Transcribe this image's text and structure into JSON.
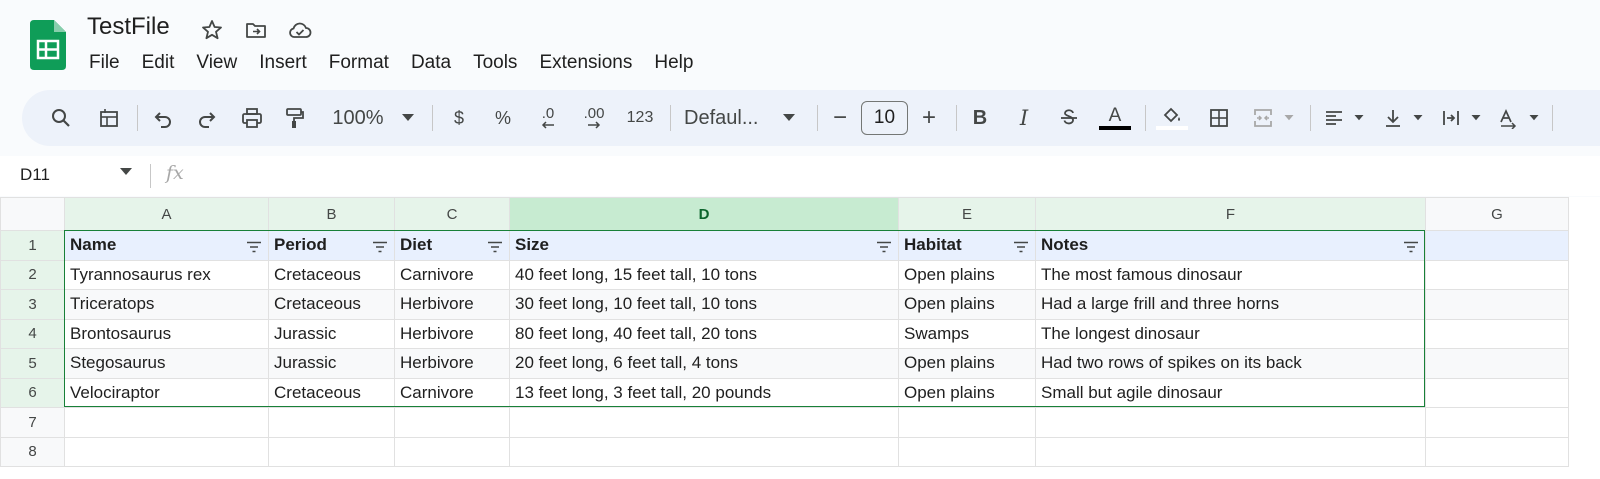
{
  "app": {
    "title": "TestFile",
    "menus": [
      "File",
      "Edit",
      "View",
      "Insert",
      "Format",
      "Data",
      "Tools",
      "Extensions",
      "Help"
    ]
  },
  "toolbar": {
    "zoom": "100%",
    "currency": "$",
    "percent": "%",
    "decrease_decimal": ".0",
    "increase_decimal": ".00",
    "number_format": "123",
    "font": "Defaul...",
    "font_size": "10",
    "minus": "−",
    "plus": "+",
    "bold": "B",
    "italic": "I",
    "text_color_glyph": "A"
  },
  "formula_bar": {
    "name_box": "D11",
    "fx": "fx"
  },
  "sheet": {
    "columns": [
      "A",
      "B",
      "C",
      "D",
      "E",
      "F",
      "G"
    ],
    "rows": [
      [
        "Name",
        "Period",
        "Diet",
        "Size",
        "Habitat",
        "Notes"
      ],
      [
        "Tyrannosaurus rex",
        "Cretaceous",
        "Carnivore",
        "40 feet long, 15 feet tall, 10 tons",
        "Open plains",
        "The most famous dinosaur"
      ],
      [
        "Triceratops",
        "Cretaceous",
        "Herbivore",
        "30 feet long, 10 feet tall, 10 tons",
        "Open plains",
        "Had a large frill and three horns"
      ],
      [
        "Brontosaurus",
        "Jurassic",
        "Herbivore",
        "80 feet long, 40 feet tall, 20 tons",
        "Swamps",
        "The longest dinosaur"
      ],
      [
        "Stegosaurus",
        "Jurassic",
        "Herbivore",
        "20 feet long, 6 feet tall, 4 tons",
        "Open plains",
        "Had two rows of spikes on its back"
      ],
      [
        "Velociraptor",
        "Cretaceous",
        "Carnivore",
        "13 feet long, 3 feet tall, 20 pounds",
        "Open plains",
        "Small but agile dinosaur"
      ],
      [
        "",
        "",
        "",
        "",
        "",
        ""
      ],
      [
        "",
        "",
        "",
        "",
        "",
        ""
      ]
    ],
    "row_numbers": [
      "1",
      "2",
      "3",
      "4",
      "5",
      "6",
      "7",
      "8"
    ]
  },
  "colors": {
    "accent_green": "#188038",
    "header_row_bg": "#e8f0fe",
    "toolbar_bg": "#edf2fa"
  }
}
